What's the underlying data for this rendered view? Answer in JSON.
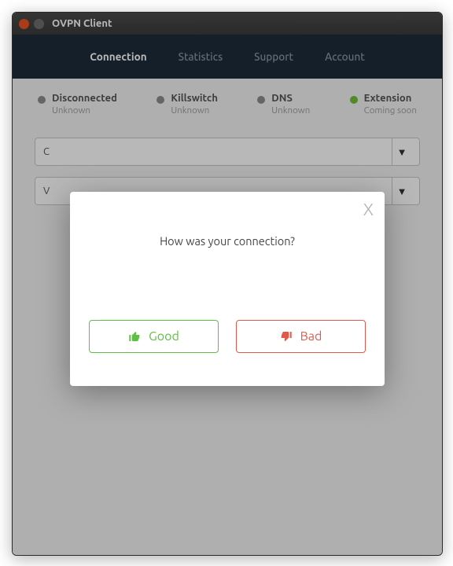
{
  "window": {
    "title": "OVPN Client"
  },
  "nav": {
    "items": [
      {
        "label": "Connection",
        "active": true
      },
      {
        "label": "Statistics",
        "active": false
      },
      {
        "label": "Support",
        "active": false
      },
      {
        "label": "Account",
        "active": false
      }
    ]
  },
  "status": [
    {
      "label": "Disconnected",
      "sub": "Unknown",
      "color": "grey"
    },
    {
      "label": "Killswitch",
      "sub": "Unknown",
      "color": "grey"
    },
    {
      "label": "DNS",
      "sub": "Unknown",
      "color": "grey"
    },
    {
      "label": "Extension",
      "sub": "Coming soon",
      "color": "green"
    }
  ],
  "selects": [
    {
      "value": "C"
    },
    {
      "value": "V"
    }
  ],
  "modal": {
    "close": "X",
    "question": "How was your connection?",
    "good": "Good",
    "bad": "Bad"
  }
}
